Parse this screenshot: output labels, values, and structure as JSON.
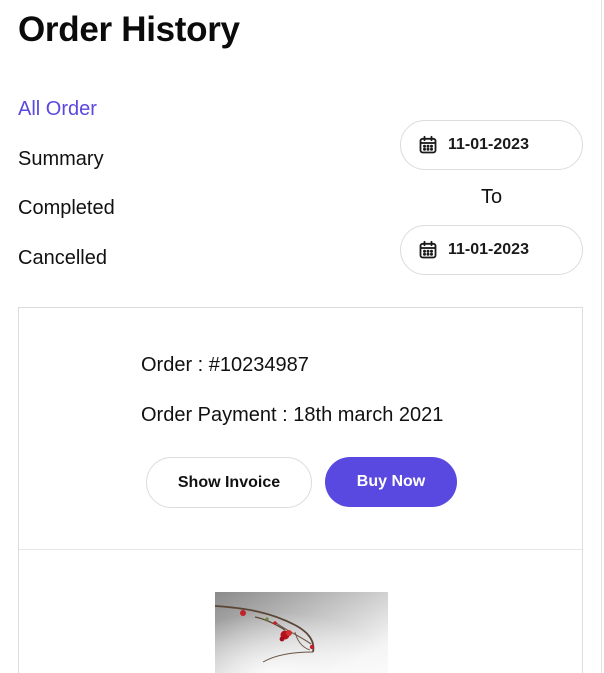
{
  "page": {
    "title": "Order History"
  },
  "filters": [
    {
      "label": "All Order",
      "active": true
    },
    {
      "label": "Summary",
      "active": false
    },
    {
      "label": "Completed",
      "active": false
    },
    {
      "label": "Cancelled",
      "active": false
    }
  ],
  "date_range": {
    "from": "11-01-2023",
    "separator": "To",
    "to": "11-01-2023",
    "icon": "calendar-icon"
  },
  "order": {
    "number": "Order : #10234987",
    "payment": "Order Payment : 18th march 2021",
    "show_invoice_label": "Show Invoice",
    "buy_now_label": "Buy Now"
  },
  "colors": {
    "accent": "#5a49e0",
    "text": "#111111",
    "border": "#dcdcdf"
  }
}
